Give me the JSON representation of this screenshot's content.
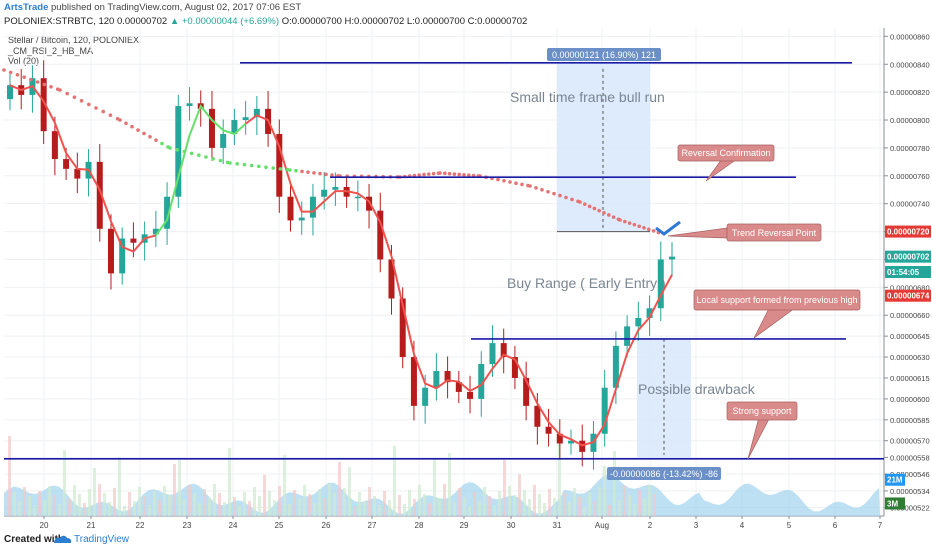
{
  "header": {
    "author": "ArtsTrade",
    "published_text": "published on TradingView.com, August 02, 2017 07:06 EST",
    "symbol_line_prefix": "POLONIEX:STRBTC, 120  0.00000702",
    "change_text": "▲ +0.00000044 (+6.69%)",
    "ohlc_text": "O:0.00000700  H:0.00000702  L:0.00000700  C:0.00000702"
  },
  "legend": {
    "title": "Stellar / Bitcoin, 120, POLONIEX",
    "indicator": "_CM_RSI_2_HB_MA",
    "volume": "Vol (20)"
  },
  "footer": {
    "created_with": "Created with",
    "brand": "TradingView"
  },
  "colors": {
    "up": "#26a69a",
    "down": "#b71c1c",
    "ma": "#ef5350",
    "ema_green": "#66e06b",
    "level_line": "#1a1aa8",
    "annotation_bg": "#d98b8b",
    "measure_box": "#d7e8fb",
    "measure_label": "#6b8fc7",
    "volume_area": "#a8d5ef"
  },
  "chart_data": {
    "type": "candlestick",
    "title": "Stellar / Bitcoin, 120, POLONIEX",
    "interval": "120",
    "x_ticks": [
      "20",
      "21",
      "22",
      "23",
      "24",
      "25",
      "26",
      "27",
      "28",
      "29",
      "30",
      "31",
      "Aug",
      "2",
      "3",
      "4",
      "5",
      "6",
      "7"
    ],
    "y_ticks": [
      "0.00000860",
      "0.00000840",
      "0.00000820",
      "0.00000800",
      "0.00000780",
      "0.00000760",
      "0.00000740",
      "0.00000720",
      "0.00000700",
      "0.00000680",
      "0.00000660",
      "0.00000645",
      "0.00000630",
      "0.00000615",
      "0.00000600",
      "0.00000585",
      "0.00000570",
      "0.00000558",
      "0.00000546",
      "0.00000534",
      "0.00000522"
    ],
    "ylim": [
      5.16e-06,
      8.66e-06
    ],
    "price_labels": [
      {
        "text": "0.00000720",
        "value": 7.2e-06,
        "color": "#e53935"
      },
      {
        "text": "0.00000702",
        "value": 7.02e-06,
        "color": "#26a69a"
      },
      {
        "text": "01:54:05",
        "value": 6.91e-06,
        "color": "#26a69a"
      },
      {
        "text": "0.00000674",
        "value": 6.74e-06,
        "color": "#e53935"
      },
      {
        "text": "21M",
        "value": 5.42e-06,
        "color": "#2196f3"
      },
      {
        "text": "3M",
        "value": 5.25e-06,
        "color": "#2e7d32"
      }
    ],
    "closes": [
      8.25e-06,
      8.18e-06,
      8.3e-06,
      7.92e-06,
      7.72e-06,
      7.65e-06,
      7.58e-06,
      7.7e-06,
      7.22e-06,
      6.9e-06,
      7.15e-06,
      7.12e-06,
      7.18e-06,
      7.22e-06,
      7.45e-06,
      8.1e-06,
      8.12e-06,
      8.08e-06,
      7.8e-06,
      7.9e-06,
      8e-06,
      8.02e-06,
      8.08e-06,
      7.9e-06,
      7.45e-06,
      7.28e-06,
      7.3e-06,
      7.45e-06,
      7.5e-06,
      7.52e-06,
      7.45e-06,
      7.45e-06,
      7.35e-06,
      7e-06,
      6.72e-06,
      6.3e-06,
      5.95e-06,
      6.08e-06,
      6.2e-06,
      6.12e-06,
      6.05e-06,
      6e-06,
      6.25e-06,
      6.4e-06,
      6.3e-06,
      6.15e-06,
      5.95e-06,
      5.8e-06,
      5.75e-06,
      5.68e-06,
      5.7e-06,
      5.62e-06,
      5.75e-06,
      6.08e-06,
      6.38e-06,
      6.52e-06,
      6.58e-06,
      6.65e-06,
      7e-06,
      7.02e-06
    ],
    "horizontal_levels": [
      8.41e-06,
      7.59e-06,
      6.43e-06,
      5.57e-06
    ],
    "measure_up": {
      "label": "0.00000121 (16.90%) 121",
      "from": 7.2e-06,
      "to": 8.41e-06
    },
    "measure_down": {
      "label": "-0.00000086 (-13.42%) -86",
      "from": 6.43e-06,
      "to": 5.57e-06
    },
    "annotations": [
      {
        "text": "Small time frame bull run"
      },
      {
        "text": "Reversal Confirmation"
      },
      {
        "text": "Trend Reversal Point"
      },
      {
        "text": "Buy Range ( Early Entry )"
      },
      {
        "text": "Local support formed from previous high"
      },
      {
        "text": "Possible drawback"
      },
      {
        "text": "Strong support"
      }
    ],
    "volume_label": "Vol (20)",
    "grid": true
  }
}
